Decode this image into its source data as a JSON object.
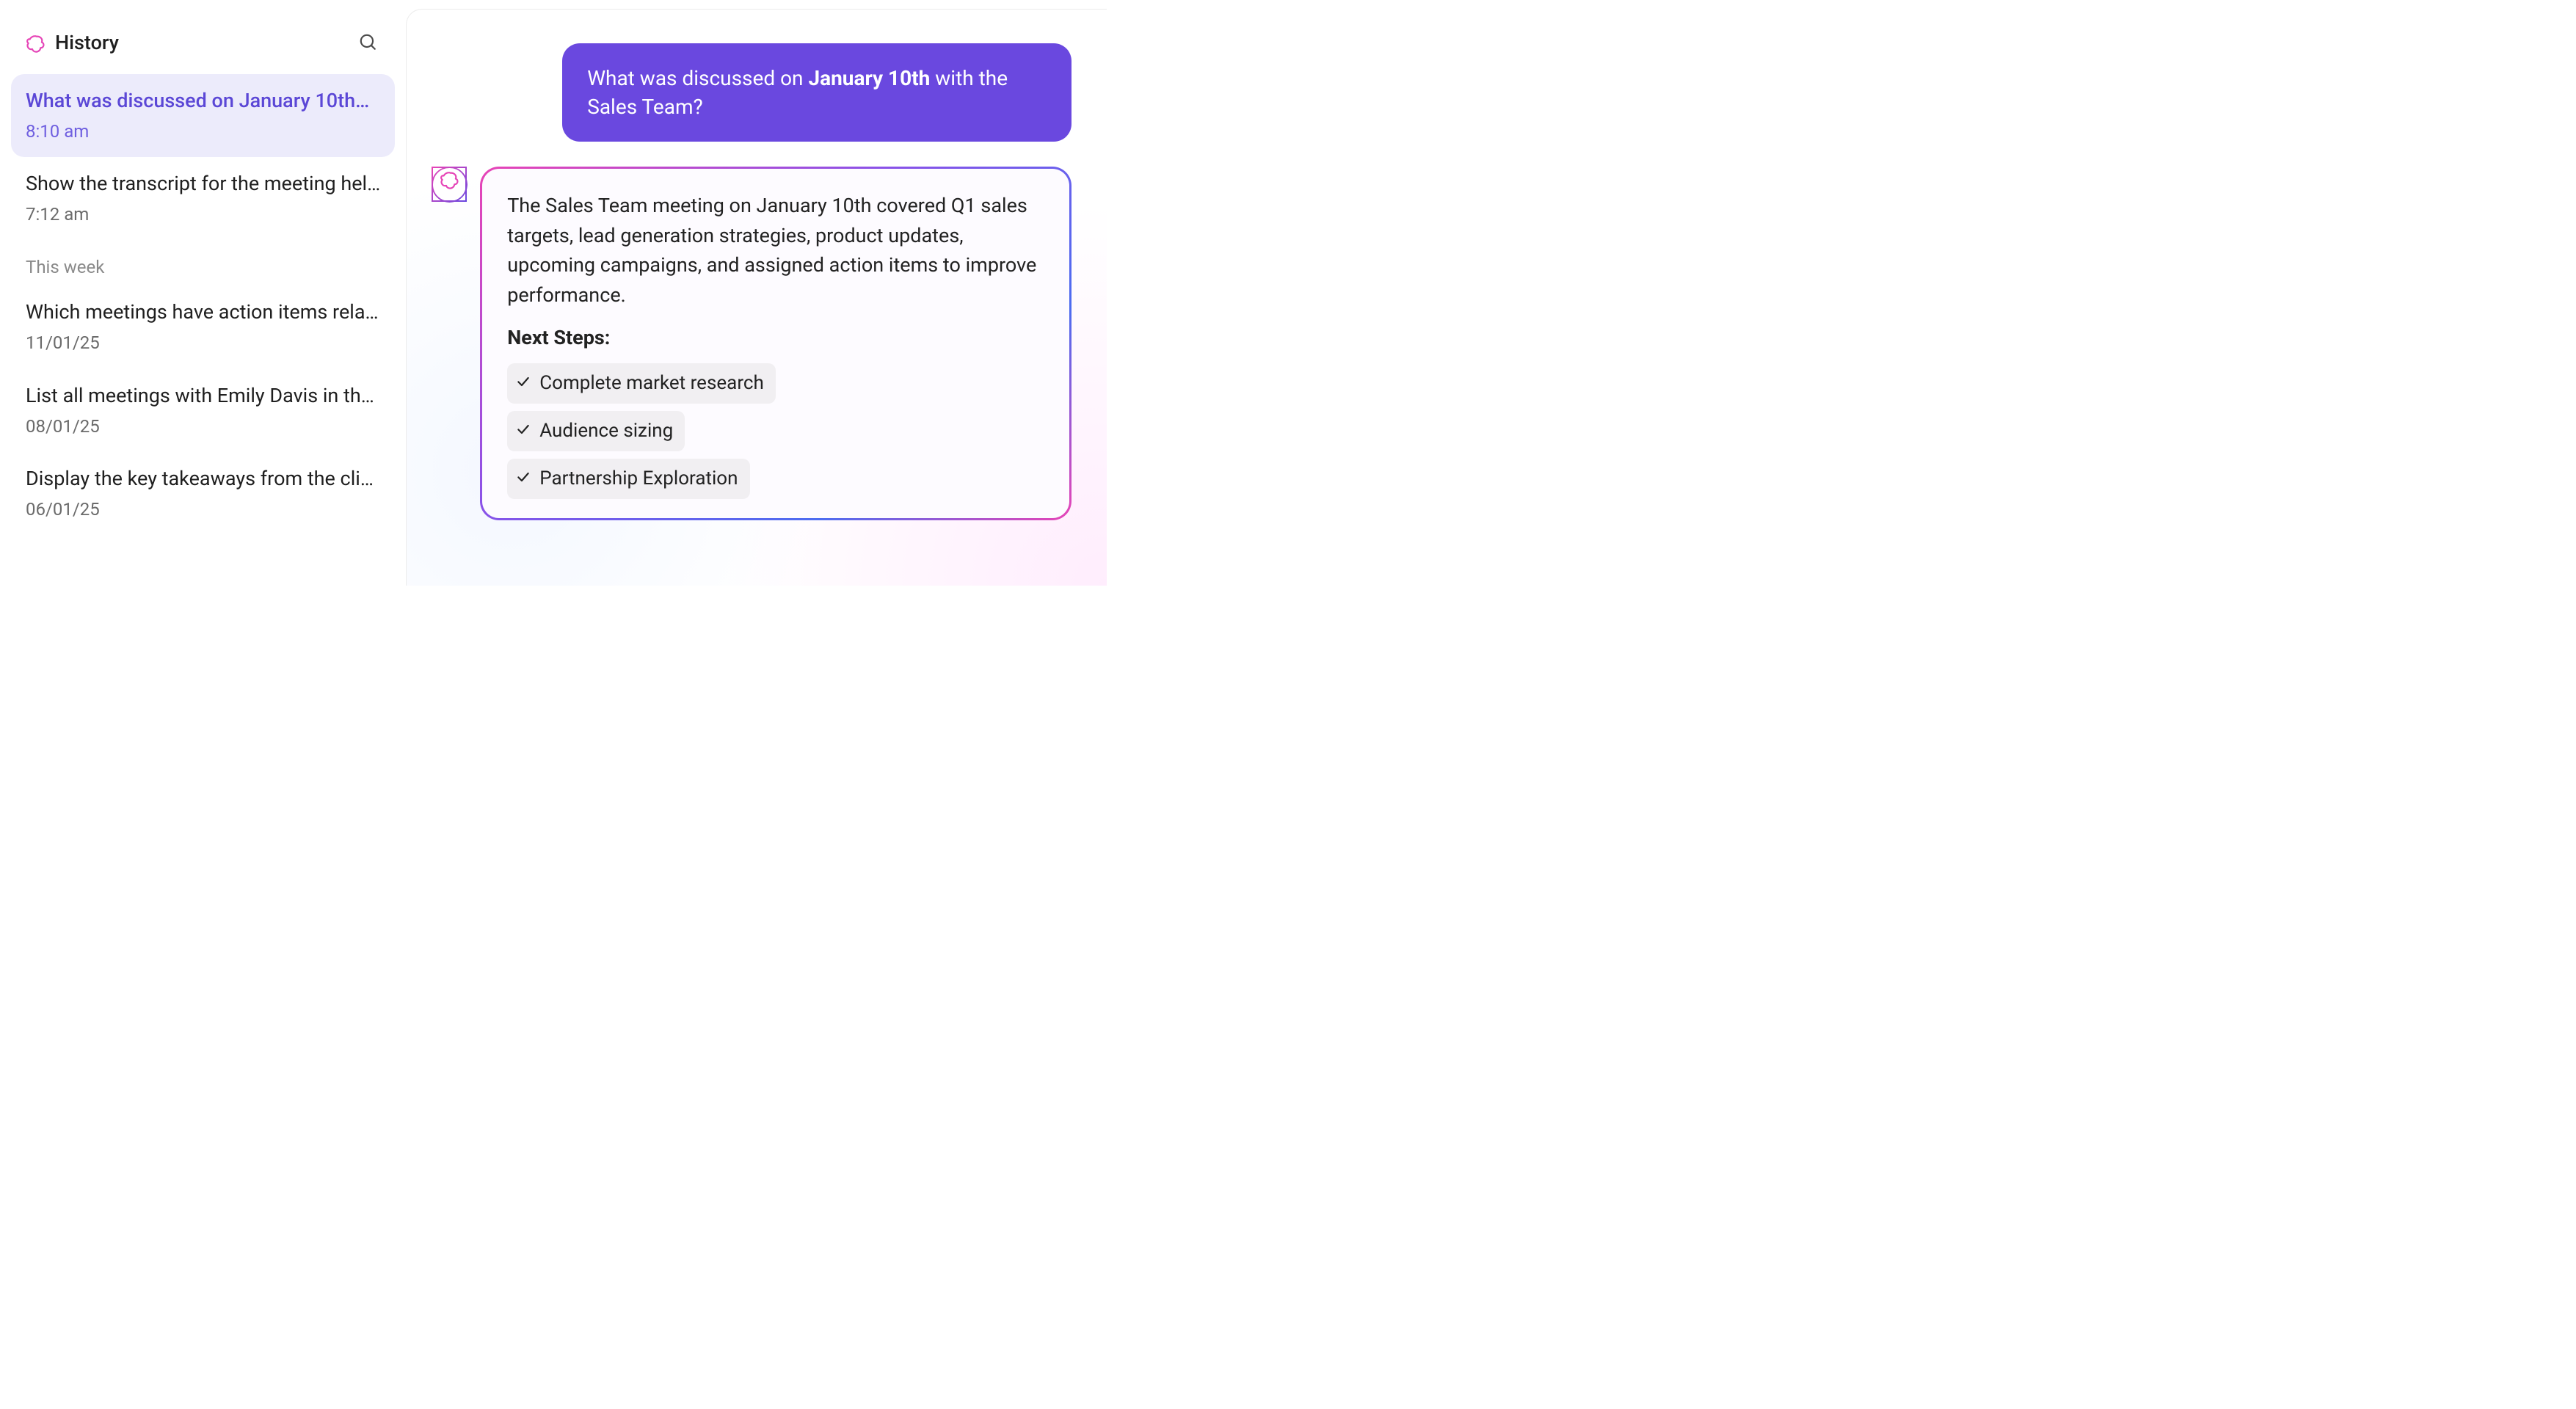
{
  "sidebar": {
    "title": "History",
    "section_label": "This week",
    "items": [
      {
        "title": "What was discussed on January 10th…",
        "time": "8:10 am",
        "active": true
      },
      {
        "title": "Show the transcript for the meeting hel…",
        "time": "7:12 am",
        "active": false
      },
      {
        "title": "Which meetings have action items rela…",
        "time": "11/01/25",
        "active": false
      },
      {
        "title": "List all meetings with Emily Davis in th…",
        "time": "08/01/25",
        "active": false
      },
      {
        "title": "Display the key takeaways from the cli…",
        "time": "06/01/25",
        "active": false
      }
    ]
  },
  "chat": {
    "user_message_prefix": "What was discussed on ",
    "user_message_bold": "January 10th",
    "user_message_suffix": " with the Sales Team?",
    "ai_summary": "The Sales Team meeting on January 10th covered Q1 sales targets, lead generation strategies, product updates, upcoming campaigns, and assigned action items to improve performance.",
    "next_steps_label": "Next Steps:",
    "next_steps": [
      "Complete market research",
      "Audience sizing",
      "Partnership Exploration"
    ]
  },
  "icons": {
    "logo": "swirl-logo-icon",
    "search": "search-icon",
    "avatar": "swirl-logo-icon",
    "check": "check-icon"
  },
  "colors": {
    "accent_primary": "#6a48df",
    "accent_pink": "#e844b6",
    "accent_blue": "#4c6cf0",
    "sidebar_active_bg": "#ecebfb",
    "chip_bg": "#f1eff2"
  }
}
